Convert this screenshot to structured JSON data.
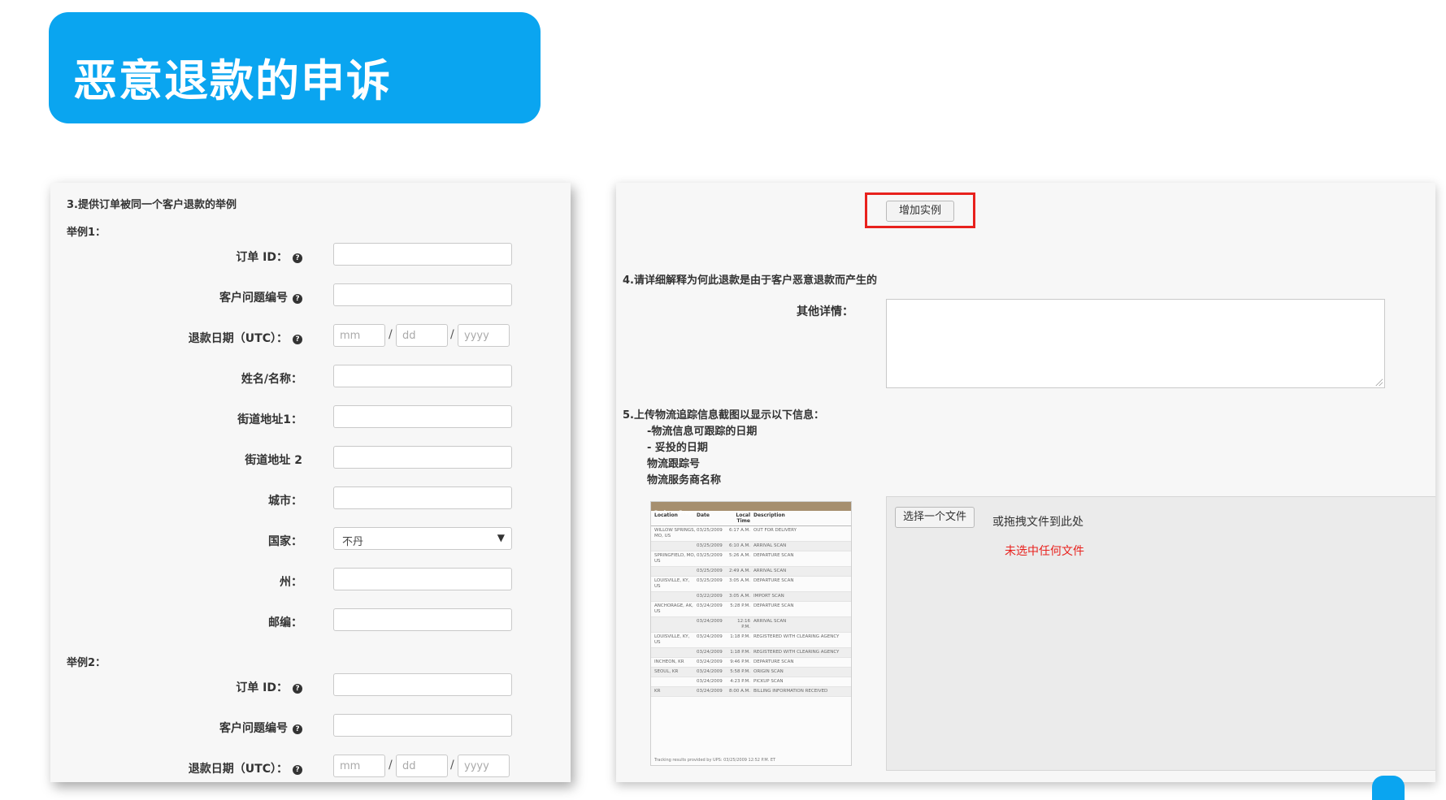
{
  "slide": {
    "title": "恶意退款的申诉"
  },
  "left_form": {
    "section_title": "3.提供订单被同一个客户退款的举例",
    "example1_label": "举例1：",
    "example2_label": "举例2：",
    "fields": {
      "order_id": "订单 ID：",
      "issue_no": "客户问题编号",
      "refund_date": "退款日期（UTC）：",
      "name": "姓名/名称：",
      "street1": "街道地址1：",
      "street2": "街道地址 2",
      "city": "城市：",
      "country": "国家：",
      "state": "州：",
      "zip": "邮编："
    },
    "date_placeholders": {
      "mm": "mm",
      "dd": "dd",
      "yyyy": "yyyy"
    },
    "country_value": "不丹",
    "help_glyph": "?",
    "select_arrow": "▼"
  },
  "right_form": {
    "add_example_button": "增加实例",
    "section4_title": "4.请详细解释为何此退款是由于客户恶意退款而产生的",
    "other_details_label": "其他详情：",
    "section5_title": "5.上传物流追踪信息截图以显示以下信息：",
    "requirements": [
      "-物流信息可跟踪的日期",
      "- 妥投的日期",
      "物流跟踪号",
      "物流服务商名称"
    ],
    "choose_file_button": "选择一个文件",
    "drop_text": "或拖拽文件到此处",
    "no_file_text": "未选中任何文件"
  },
  "tracking_image": {
    "title": "Package Progress",
    "columns": [
      "Location",
      "Date",
      "Local Time",
      "Description"
    ],
    "rows": [
      [
        "WILLOW SPRINGS, MO, US",
        "03/25/2009",
        "6:17 A.M.",
        "OUT FOR DELIVERY"
      ],
      [
        "",
        "03/25/2009",
        "6:10 A.M.",
        "ARRIVAL SCAN"
      ],
      [
        "SPRINGFIELD, MO, US",
        "03/25/2009",
        "5:26 A.M.",
        "DEPARTURE SCAN"
      ],
      [
        "",
        "03/25/2009",
        "2:49 A.M.",
        "ARRIVAL SCAN"
      ],
      [
        "LOUISVILLE, KY, US",
        "03/25/2009",
        "3:05 A.M.",
        "DEPARTURE SCAN"
      ],
      [
        "",
        "03/22/2009",
        "3:05 A.M.",
        "IMPORT SCAN"
      ],
      [
        "ANCHORAGE, AK, US",
        "03/24/2009",
        "5:28 P.M.",
        "DEPARTURE SCAN"
      ],
      [
        "",
        "03/24/2009",
        "12:16 P.M.",
        "ARRIVAL SCAN"
      ],
      [
        "LOUISVILLE, KY, US",
        "03/24/2009",
        "1:18 P.M.",
        "REGISTERED WITH CLEARING AGENCY"
      ],
      [
        "",
        "03/24/2009",
        "1:18 P.M.",
        "REGISTERED WITH CLEARING AGENCY"
      ],
      [
        "INCHEON, KR",
        "03/24/2009",
        "9:46 P.M.",
        "DEPARTURE SCAN"
      ],
      [
        "SEOUL, KR",
        "03/24/2009",
        "5:58 P.M.",
        "ORIGIN SCAN"
      ],
      [
        "",
        "03/24/2009",
        "4:23 P.M.",
        "PICKUP SCAN"
      ],
      [
        "KR",
        "03/24/2009",
        "8:00 A.M.",
        "BILLING INFORMATION RECEIVED"
      ]
    ],
    "footer": "Tracking results provided by UPS: 03/25/2009 12:52 P.M. ET"
  }
}
